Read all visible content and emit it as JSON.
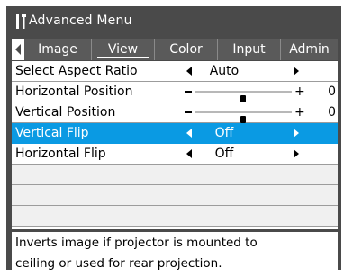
{
  "window": {
    "title": "Advanced Menu",
    "title_icon": "wrench-screwdriver-icon",
    "colors": {
      "frame": "#4a4a4a",
      "selection": "#0a9ae3",
      "text": "#000000"
    }
  },
  "tabs": [
    {
      "label": "Image",
      "active": false
    },
    {
      "label": "View",
      "active": true
    },
    {
      "label": "Color",
      "active": false
    },
    {
      "label": "Input",
      "active": false
    },
    {
      "label": "Admin",
      "active": false
    }
  ],
  "menu": {
    "rows": [
      {
        "label": "Select Aspect Ratio",
        "type": "select",
        "value": "Auto",
        "selected": false
      },
      {
        "label": "Horizontal Position",
        "type": "slider",
        "minus": "−",
        "plus": "+",
        "value": "0",
        "level": 0.5,
        "selected": false
      },
      {
        "label": "Vertical Position",
        "type": "slider",
        "minus": "−",
        "plus": "+",
        "value": "0",
        "level": 0.5,
        "selected": false
      },
      {
        "label": "Vertical Flip",
        "type": "select",
        "value": "Off",
        "selected": true
      },
      {
        "label": "Horizontal Flip",
        "type": "select",
        "value": "Off",
        "selected": false
      }
    ],
    "empty_rows": 3
  },
  "help": {
    "line1": "Inverts image if projector is mounted to",
    "line2": "ceiling or used for rear projection."
  }
}
